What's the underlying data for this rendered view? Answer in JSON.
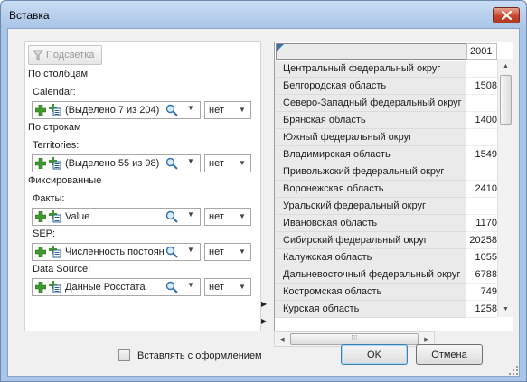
{
  "window": {
    "title": "Вставка"
  },
  "left": {
    "highlight_button": "Подсветка",
    "sections": {
      "columns": "По столбцам",
      "rows": "По строкам",
      "fixed": "Фиксированные"
    },
    "dimensions": [
      {
        "label": "Calendar:",
        "value": "(Выделено 7 из 204)",
        "aggregation": "нет"
      },
      {
        "label": "Territories:",
        "value": "(Выделено 55 из 98)",
        "aggregation": "нет"
      },
      {
        "label": "Факты:",
        "value": "Value",
        "aggregation": "нет"
      },
      {
        "label": "SEP:",
        "value": "Численность постоян",
        "aggregation": "нет"
      },
      {
        "label": "Data Source:",
        "value": "Данные Росстата",
        "aggregation": "нет"
      }
    ]
  },
  "grid": {
    "column_header": "2001",
    "rows": [
      {
        "label": "Центральный федеральный округ",
        "value": ""
      },
      {
        "label": "Белгородская область",
        "value": "1508"
      },
      {
        "label": "Северо-Западный федеральный округ",
        "value": ""
      },
      {
        "label": "Брянская область",
        "value": "1400"
      },
      {
        "label": "Южный федеральный округ",
        "value": ""
      },
      {
        "label": "Владимирская область",
        "value": "1549"
      },
      {
        "label": "Привольжский федеральный округ",
        "value": ""
      },
      {
        "label": "Воронежская область",
        "value": "2410"
      },
      {
        "label": "Уральский федеральный округ",
        "value": ""
      },
      {
        "label": "Ивановская область",
        "value": "1170"
      },
      {
        "label": "Сибирский федеральный округ",
        "value": "20258"
      },
      {
        "label": "Калужская область",
        "value": "1055"
      },
      {
        "label": "Дальневосточный федеральный округ",
        "value": "6788"
      },
      {
        "label": "Костромская область",
        "value": "749"
      },
      {
        "label": "Курская область",
        "value": "1258"
      }
    ]
  },
  "footer": {
    "keep_formatting_label": "Вставлять с оформлением",
    "ok_label": "OK",
    "cancel_label": "Отмена"
  },
  "colors": {
    "title_bg": "#a9c5e8",
    "close_red": "#c8452c",
    "ok_border": "#3c7fb1"
  }
}
